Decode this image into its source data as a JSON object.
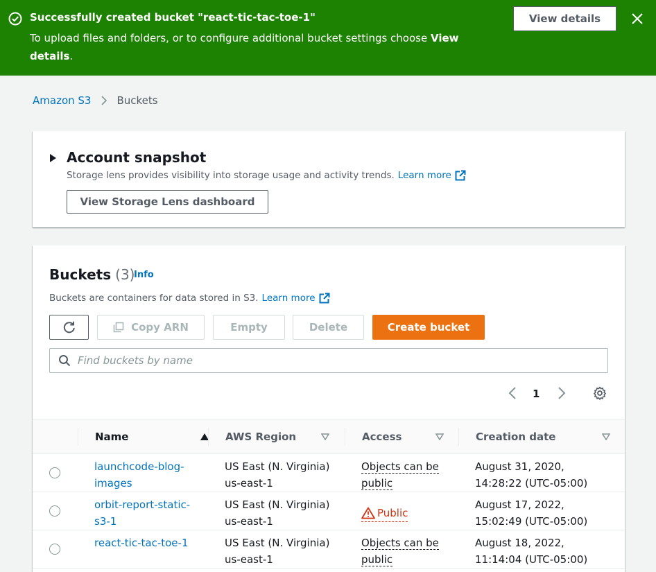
{
  "flash": {
    "title": "Successfully created bucket \"react-tic-tac-toe-1\"",
    "body_prefix": "To upload files and folders, or to configure additional bucket settings choose ",
    "body_bold": "View details",
    "body_suffix": ".",
    "button_label": "View details"
  },
  "breadcrumb": {
    "root": "Amazon S3",
    "current": "Buckets"
  },
  "snapshot": {
    "title": "Account snapshot",
    "description": "Storage lens provides visibility into storage usage and activity trends.",
    "learn_more": "Learn more",
    "button_label": "View Storage Lens dashboard"
  },
  "buckets": {
    "title": "Buckets",
    "count": "(3)",
    "info": "Info",
    "description": "Buckets are containers for data stored in S3.",
    "learn_more": "Learn more",
    "actions": {
      "copy_arn": "Copy ARN",
      "empty": "Empty",
      "delete": "Delete",
      "create": "Create bucket"
    },
    "search_placeholder": "Find buckets by name",
    "page": "1",
    "columns": [
      "Name",
      "AWS Region",
      "Access",
      "Creation date"
    ],
    "rows": [
      {
        "name": "launchcode-blog-images",
        "region": "US East (N. Virginia) us-east-1",
        "access": "Objects can be public",
        "date": "August 31, 2020, 14:28:22 (UTC-05:00)"
      },
      {
        "name": "orbit-report-static-s3-1",
        "region": "US East (N. Virginia) us-east-1",
        "access": "Public",
        "date": "August 17, 2022, 15:02:49 (UTC-05:00)"
      },
      {
        "name": "react-tic-tac-toe-1",
        "region": "US East (N. Virginia) us-east-1",
        "access": "Objects can be public",
        "date": "August 18, 2022, 11:14:04 (UTC-05:00)"
      }
    ]
  },
  "colors": {
    "success": "#1d8102",
    "link": "#0073bb",
    "primary": "#ec7211",
    "danger": "#d13212"
  }
}
